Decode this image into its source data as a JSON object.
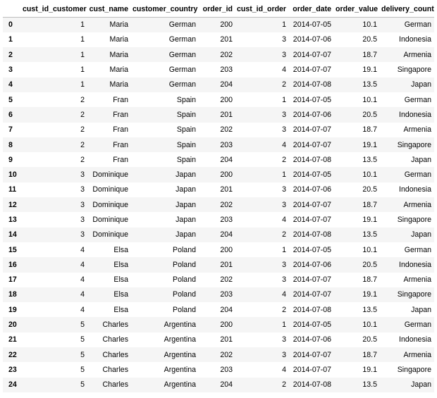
{
  "dataframe": {
    "columns": [
      "",
      "cust_id_customer",
      "cust_name",
      "customer_country",
      "order_id",
      "cust_id_order",
      "order_date",
      "order_value",
      "delivery_country"
    ],
    "rows": [
      [
        "0",
        "1",
        "Maria",
        "German",
        "200",
        "1",
        "2014-07-05",
        "10.1",
        "German"
      ],
      [
        "1",
        "1",
        "Maria",
        "German",
        "201",
        "3",
        "2014-07-06",
        "20.5",
        "Indonesia"
      ],
      [
        "2",
        "1",
        "Maria",
        "German",
        "202",
        "3",
        "2014-07-07",
        "18.7",
        "Armenia"
      ],
      [
        "3",
        "1",
        "Maria",
        "German",
        "203",
        "4",
        "2014-07-07",
        "19.1",
        "Singapore"
      ],
      [
        "4",
        "1",
        "Maria",
        "German",
        "204",
        "2",
        "2014-07-08",
        "13.5",
        "Japan"
      ],
      [
        "5",
        "2",
        "Fran",
        "Spain",
        "200",
        "1",
        "2014-07-05",
        "10.1",
        "German"
      ],
      [
        "6",
        "2",
        "Fran",
        "Spain",
        "201",
        "3",
        "2014-07-06",
        "20.5",
        "Indonesia"
      ],
      [
        "7",
        "2",
        "Fran",
        "Spain",
        "202",
        "3",
        "2014-07-07",
        "18.7",
        "Armenia"
      ],
      [
        "8",
        "2",
        "Fran",
        "Spain",
        "203",
        "4",
        "2014-07-07",
        "19.1",
        "Singapore"
      ],
      [
        "9",
        "2",
        "Fran",
        "Spain",
        "204",
        "2",
        "2014-07-08",
        "13.5",
        "Japan"
      ],
      [
        "10",
        "3",
        "Dominique",
        "Japan",
        "200",
        "1",
        "2014-07-05",
        "10.1",
        "German"
      ],
      [
        "11",
        "3",
        "Dominique",
        "Japan",
        "201",
        "3",
        "2014-07-06",
        "20.5",
        "Indonesia"
      ],
      [
        "12",
        "3",
        "Dominique",
        "Japan",
        "202",
        "3",
        "2014-07-07",
        "18.7",
        "Armenia"
      ],
      [
        "13",
        "3",
        "Dominique",
        "Japan",
        "203",
        "4",
        "2014-07-07",
        "19.1",
        "Singapore"
      ],
      [
        "14",
        "3",
        "Dominique",
        "Japan",
        "204",
        "2",
        "2014-07-08",
        "13.5",
        "Japan"
      ],
      [
        "15",
        "4",
        "Elsa",
        "Poland",
        "200",
        "1",
        "2014-07-05",
        "10.1",
        "German"
      ],
      [
        "16",
        "4",
        "Elsa",
        "Poland",
        "201",
        "3",
        "2014-07-06",
        "20.5",
        "Indonesia"
      ],
      [
        "17",
        "4",
        "Elsa",
        "Poland",
        "202",
        "3",
        "2014-07-07",
        "18.7",
        "Armenia"
      ],
      [
        "18",
        "4",
        "Elsa",
        "Poland",
        "203",
        "4",
        "2014-07-07",
        "19.1",
        "Singapore"
      ],
      [
        "19",
        "4",
        "Elsa",
        "Poland",
        "204",
        "2",
        "2014-07-08",
        "13.5",
        "Japan"
      ],
      [
        "20",
        "5",
        "Charles",
        "Argentina",
        "200",
        "1",
        "2014-07-05",
        "10.1",
        "German"
      ],
      [
        "21",
        "5",
        "Charles",
        "Argentina",
        "201",
        "3",
        "2014-07-06",
        "20.5",
        "Indonesia"
      ],
      [
        "22",
        "5",
        "Charles",
        "Argentina",
        "202",
        "3",
        "2014-07-07",
        "18.7",
        "Armenia"
      ],
      [
        "23",
        "5",
        "Charles",
        "Argentina",
        "203",
        "4",
        "2014-07-07",
        "19.1",
        "Singapore"
      ],
      [
        "24",
        "5",
        "Charles",
        "Argentina",
        "204",
        "2",
        "2014-07-08",
        "13.5",
        "Japan"
      ]
    ]
  },
  "colors": {
    "stripe": "#f5f5f5",
    "header_rule": "#bdbdbd",
    "text": "#000000"
  }
}
